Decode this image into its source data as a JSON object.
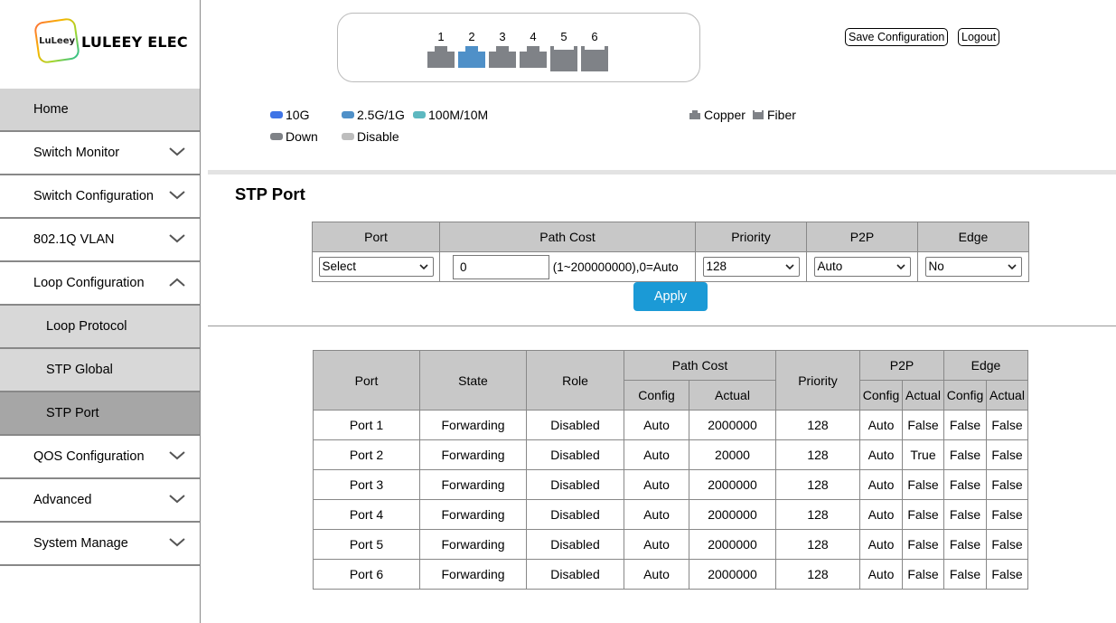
{
  "brand": {
    "badge": "LuLeey",
    "name": "LULEEY ELEC"
  },
  "sidebar": {
    "items": [
      {
        "label": "Home"
      },
      {
        "label": "Switch Monitor"
      },
      {
        "label": "Switch Configuration"
      },
      {
        "label": "802.1Q VLAN"
      },
      {
        "label": "Loop Configuration"
      },
      {
        "label": "Loop Protocol"
      },
      {
        "label": "STP Global"
      },
      {
        "label": "STP Port"
      },
      {
        "label": "QOS Configuration"
      },
      {
        "label": "Advanced"
      },
      {
        "label": "System Manage"
      }
    ]
  },
  "header": {
    "ports": [
      "1",
      "2",
      "3",
      "4",
      "5",
      "6"
    ],
    "save_label": "Save Configuration",
    "logout_label": "Logout",
    "legend": {
      "speed_10g": "10G",
      "speed_2_5g": "2.5G/1G",
      "speed_100m": "100M/10M",
      "down": "Down",
      "disable": "Disable",
      "copper": "Copper",
      "fiber": "Fiber"
    }
  },
  "colors": {
    "speed_10g": "#3f74e6",
    "speed_2_5g": "#4f90c8",
    "speed_100m": "#5db8c0",
    "down": "#7f8287",
    "disable": "#bdbdbd",
    "accent": "#1b9ad6"
  },
  "page_title": "STP Port",
  "config": {
    "headers": {
      "port": "Port",
      "path_cost": "Path Cost",
      "priority": "Priority",
      "p2p": "P2P",
      "edge": "Edge"
    },
    "port_value": "Select",
    "path_cost_value": "0",
    "path_cost_hint": "(1~200000000),0=Auto",
    "priority_value": "128",
    "p2p_value": "Auto",
    "edge_value": "No",
    "apply_label": "Apply"
  },
  "status": {
    "headers": {
      "port": "Port",
      "state": "State",
      "role": "Role",
      "path_cost": "Path Cost",
      "priority": "Priority",
      "p2p": "P2P",
      "edge": "Edge",
      "config": "Config",
      "actual": "Actual"
    },
    "rows": [
      {
        "port": "Port 1",
        "state": "Forwarding",
        "role": "Disabled",
        "pc_config": "Auto",
        "pc_actual": "2000000",
        "priority": "128",
        "p2p_config": "Auto",
        "p2p_actual": "False",
        "edge_config": "False",
        "edge_actual": "False"
      },
      {
        "port": "Port 2",
        "state": "Forwarding",
        "role": "Disabled",
        "pc_config": "Auto",
        "pc_actual": "20000",
        "priority": "128",
        "p2p_config": "Auto",
        "p2p_actual": "True",
        "edge_config": "False",
        "edge_actual": "False"
      },
      {
        "port": "Port 3",
        "state": "Forwarding",
        "role": "Disabled",
        "pc_config": "Auto",
        "pc_actual": "2000000",
        "priority": "128",
        "p2p_config": "Auto",
        "p2p_actual": "False",
        "edge_config": "False",
        "edge_actual": "False"
      },
      {
        "port": "Port 4",
        "state": "Forwarding",
        "role": "Disabled",
        "pc_config": "Auto",
        "pc_actual": "2000000",
        "priority": "128",
        "p2p_config": "Auto",
        "p2p_actual": "False",
        "edge_config": "False",
        "edge_actual": "False"
      },
      {
        "port": "Port 5",
        "state": "Forwarding",
        "role": "Disabled",
        "pc_config": "Auto",
        "pc_actual": "2000000",
        "priority": "128",
        "p2p_config": "Auto",
        "p2p_actual": "False",
        "edge_config": "False",
        "edge_actual": "False"
      },
      {
        "port": "Port 6",
        "state": "Forwarding",
        "role": "Disabled",
        "pc_config": "Auto",
        "pc_actual": "2000000",
        "priority": "128",
        "p2p_config": "Auto",
        "p2p_actual": "False",
        "edge_config": "False",
        "edge_actual": "False"
      }
    ]
  }
}
